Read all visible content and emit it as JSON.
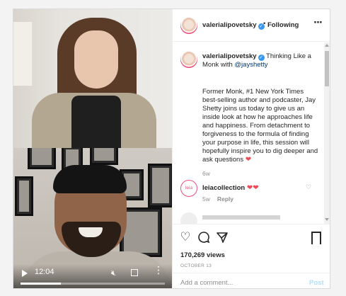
{
  "post": {
    "username": "valerialipovetsky",
    "verified_icon": "verified-badge-icon",
    "follow_separator": "•",
    "follow_label": "Following",
    "options_icon": "more-options-icon",
    "caption_title": "Thinking Like a Monk with ",
    "caption_mention": "@jayshetty",
    "caption_body": "Former Monk, #1 New York Times best-selling author and podcaster, Jay Shetty joins us today to give us an inside look at how he approaches life and happiness. From detachment to forgiveness to the formula of finding your purpose in life, this session will hopefully inspire you to dig deeper and ask questions ",
    "caption_emoji": "❤",
    "caption_age": "6w",
    "comments": [
      {
        "username": "leiacollection",
        "avatar_text": "leia",
        "text": "❤❤",
        "age": "5w",
        "reply_label": "Reply"
      }
    ],
    "views_count": "170,269",
    "views_label": " views",
    "date": "OCTOBER 13",
    "add_comment_placeholder": "Add a comment...",
    "post_button": "Post"
  },
  "video": {
    "time": "12:04",
    "progress": 0.28
  },
  "colors": {
    "link": "#00376b",
    "verified": "#3897f0",
    "heart": "#ed4956",
    "post_disabled": "#b2dffc"
  }
}
